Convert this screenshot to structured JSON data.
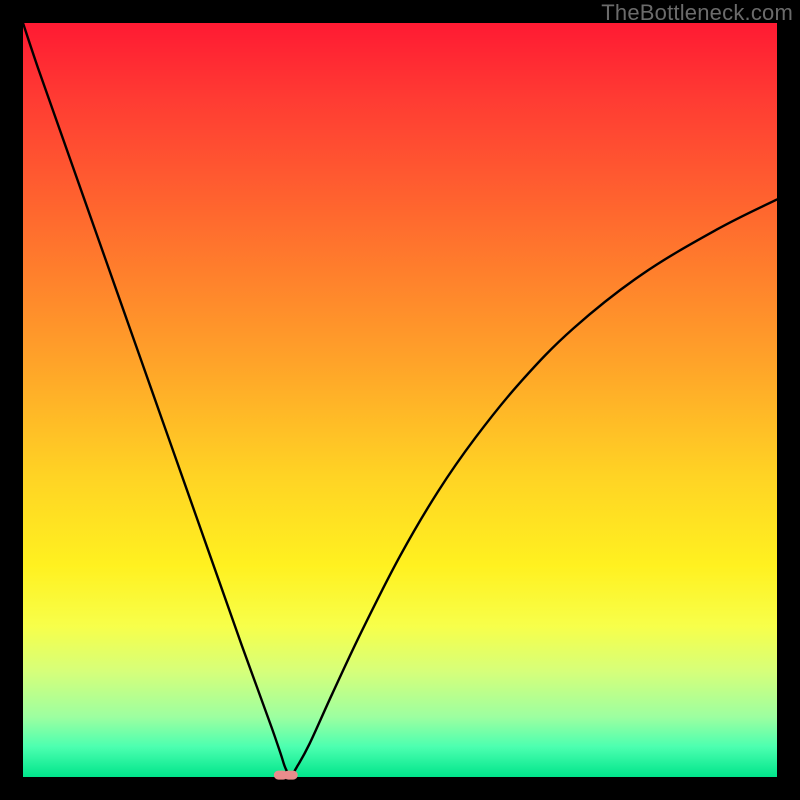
{
  "watermark": "TheBottleneck.com",
  "chart_data": {
    "type": "line",
    "title": "",
    "xlabel": "",
    "ylabel": "",
    "xlim": [
      0,
      100
    ],
    "ylim": [
      0,
      100
    ],
    "grid": false,
    "series": [
      {
        "name": "bottleneck-curve",
        "color": "#000000",
        "x": [
          0,
          2,
          5,
          8,
          11,
          14,
          17,
          20,
          23,
          26,
          29,
          31,
          33,
          34.2,
          34.8,
          35.5,
          36.3,
          38,
          41,
          45,
          50,
          55,
          60,
          66,
          73,
          82,
          92,
          100
        ],
        "y": [
          100,
          94,
          85.5,
          77,
          68.5,
          60,
          51.5,
          43,
          34.5,
          26,
          17.5,
          12,
          6.5,
          3.0,
          1.2,
          0.2,
          1.3,
          4.4,
          11.0,
          19.5,
          29.3,
          37.8,
          45.0,
          52.4,
          59.5,
          66.6,
          72.6,
          76.6
        ]
      }
    ],
    "markers": [
      {
        "name": "dip-marker-left",
        "x": 34.2,
        "y": 0.25,
        "color": "#e98c8c"
      },
      {
        "name": "dip-marker-right",
        "x": 35.5,
        "y": 0.25,
        "color": "#e98c8c"
      }
    ]
  }
}
